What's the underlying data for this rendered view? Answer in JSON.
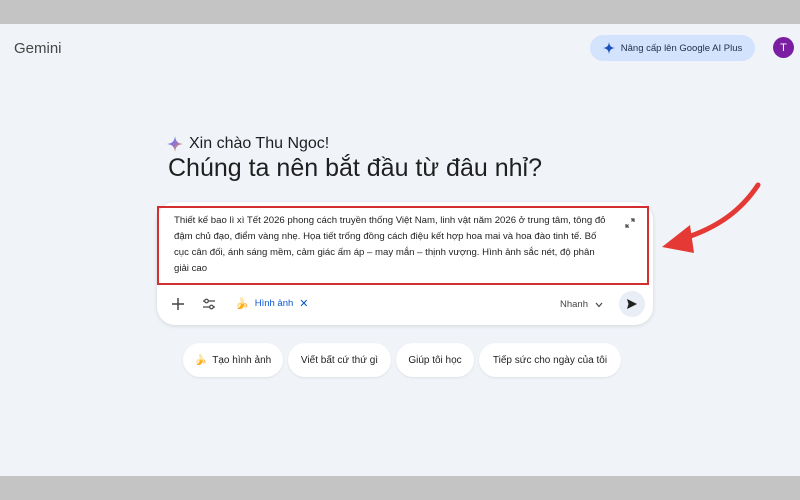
{
  "app": {
    "name": "Gemini"
  },
  "header": {
    "upgrade_label": "Nâng cấp lên Google AI Plus",
    "avatar_letter": "T"
  },
  "welcome": {
    "greeting": "Xin chào Thu Ngoc!",
    "headline": "Chúng ta nên bắt đầu từ đâu nhỉ?"
  },
  "composer": {
    "prompt_text": "Thiết kế bao lì xì Tết 2026 phong cách truyền thống Việt Nam, linh vật năm 2026 ở trung tâm, tông đỏ đậm chủ đạo, điểm vàng nhẹ. Họa tiết trống đồng cách điệu kết hợp hoa mai và hoa đào tinh tế. Bố cục cân đối, ánh sáng mềm, cảm giác ấm áp – may mắn – thịnh vượng. Hình ảnh sắc nét, độ phân giải cao",
    "tool_chip": {
      "label": "Hình ảnh",
      "icon": "banana-icon"
    },
    "mode": "Nhanh",
    "highlight_color": "#d32f2f"
  },
  "suggestions": [
    {
      "label": "Tạo hình ảnh",
      "icon": "banana-icon"
    },
    {
      "label": "Viết bất cứ thứ gì"
    },
    {
      "label": "Giúp tôi học"
    },
    {
      "label": "Tiếp sức cho ngày của tôi"
    }
  ],
  "colors": {
    "accent": "#0b57d0",
    "annotation_arrow": "#e53935",
    "avatar": "#7b1fa2"
  }
}
